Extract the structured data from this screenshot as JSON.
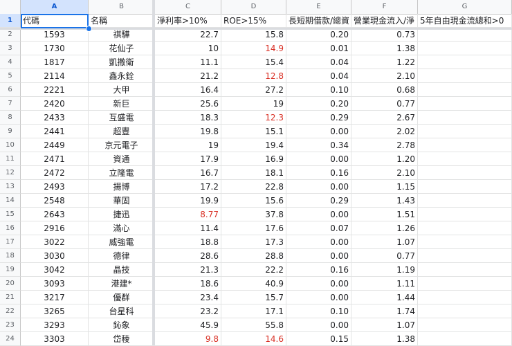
{
  "column_headers": [
    "A",
    "B",
    "C",
    "D",
    "E",
    "F",
    "G"
  ],
  "header_row": {
    "row_number": "1",
    "cells": [
      "代碼",
      "名稱",
      "淨利率>10%",
      "ROE>15%",
      "長短期借款/總資",
      "營業現金流入/淨",
      "5年自由現金流總和>0"
    ]
  },
  "rows": [
    {
      "n": "2",
      "code": "1593",
      "name": "祺驊",
      "c": "22.7",
      "d": "15.8",
      "e": "0.20",
      "f": "0.73"
    },
    {
      "n": "3",
      "code": "1730",
      "name": "花仙子",
      "c": "10",
      "d": "14.9",
      "e": "0.01",
      "f": "1.38"
    },
    {
      "n": "4",
      "code": "1817",
      "name": "凱撒衛",
      "c": "11.1",
      "d": "15.4",
      "e": "0.04",
      "f": "1.22"
    },
    {
      "n": "5",
      "code": "2114",
      "name": "鑫永銓",
      "c": "21.2",
      "d": "12.8",
      "e": "0.04",
      "f": "2.10"
    },
    {
      "n": "6",
      "code": "2221",
      "name": "大甲",
      "c": "16.4",
      "d": "27.2",
      "e": "0.10",
      "f": "0.68"
    },
    {
      "n": "7",
      "code": "2420",
      "name": "新巨",
      "c": "25.6",
      "d": "19",
      "e": "0.20",
      "f": "0.77"
    },
    {
      "n": "8",
      "code": "2433",
      "name": "互盛電",
      "c": "18.3",
      "d": "12.3",
      "e": "0.29",
      "f": "2.67"
    },
    {
      "n": "9",
      "code": "2441",
      "name": "超豐",
      "c": "19.8",
      "d": "15.1",
      "e": "0.00",
      "f": "2.02"
    },
    {
      "n": "10",
      "code": "2449",
      "name": "京元電子",
      "c": "19",
      "d": "19.4",
      "e": "0.34",
      "f": "2.78"
    },
    {
      "n": "11",
      "code": "2471",
      "name": "資通",
      "c": "17.9",
      "d": "16.9",
      "e": "0.00",
      "f": "1.20"
    },
    {
      "n": "12",
      "code": "2472",
      "name": "立隆電",
      "c": "16.7",
      "d": "18.1",
      "e": "0.16",
      "f": "2.10"
    },
    {
      "n": "13",
      "code": "2493",
      "name": "揚博",
      "c": "17.2",
      "d": "22.8",
      "e": "0.00",
      "f": "1.15"
    },
    {
      "n": "14",
      "code": "2548",
      "name": "華固",
      "c": "19.9",
      "d": "15.6",
      "e": "0.29",
      "f": "1.43"
    },
    {
      "n": "15",
      "code": "2643",
      "name": "捷迅",
      "c": "8.77",
      "d": "37.8",
      "e": "0.00",
      "f": "1.51"
    },
    {
      "n": "16",
      "code": "2916",
      "name": "滿心",
      "c": "11.4",
      "d": "17.6",
      "e": "0.07",
      "f": "1.26"
    },
    {
      "n": "17",
      "code": "3022",
      "name": "威強電",
      "c": "18.8",
      "d": "17.3",
      "e": "0.00",
      "f": "1.07"
    },
    {
      "n": "18",
      "code": "3030",
      "name": "德律",
      "c": "28.6",
      "d": "28.8",
      "e": "0.00",
      "f": "0.77"
    },
    {
      "n": "19",
      "code": "3042",
      "name": "晶技",
      "c": "21.3",
      "d": "22.2",
      "e": "0.16",
      "f": "1.19"
    },
    {
      "n": "20",
      "code": "3093",
      "name": "港建*",
      "c": "18.6",
      "d": "40.9",
      "e": "0.00",
      "f": "1.11"
    },
    {
      "n": "21",
      "code": "3217",
      "name": "優群",
      "c": "23.4",
      "d": "15.7",
      "e": "0.00",
      "f": "1.44"
    },
    {
      "n": "22",
      "code": "3265",
      "name": "台星科",
      "c": "23.2",
      "d": "17.1",
      "e": "0.10",
      "f": "1.74"
    },
    {
      "n": "23",
      "code": "3293",
      "name": "鈊象",
      "c": "45.9",
      "d": "55.8",
      "e": "0.00",
      "f": "1.07"
    },
    {
      "n": "24",
      "code": "3303",
      "name": "岱稜",
      "c": "9.8",
      "d": "14.6",
      "e": "0.15",
      "f": "1.38"
    }
  ],
  "highlight_color": "#d93025",
  "selection_color": "#1a73e8"
}
